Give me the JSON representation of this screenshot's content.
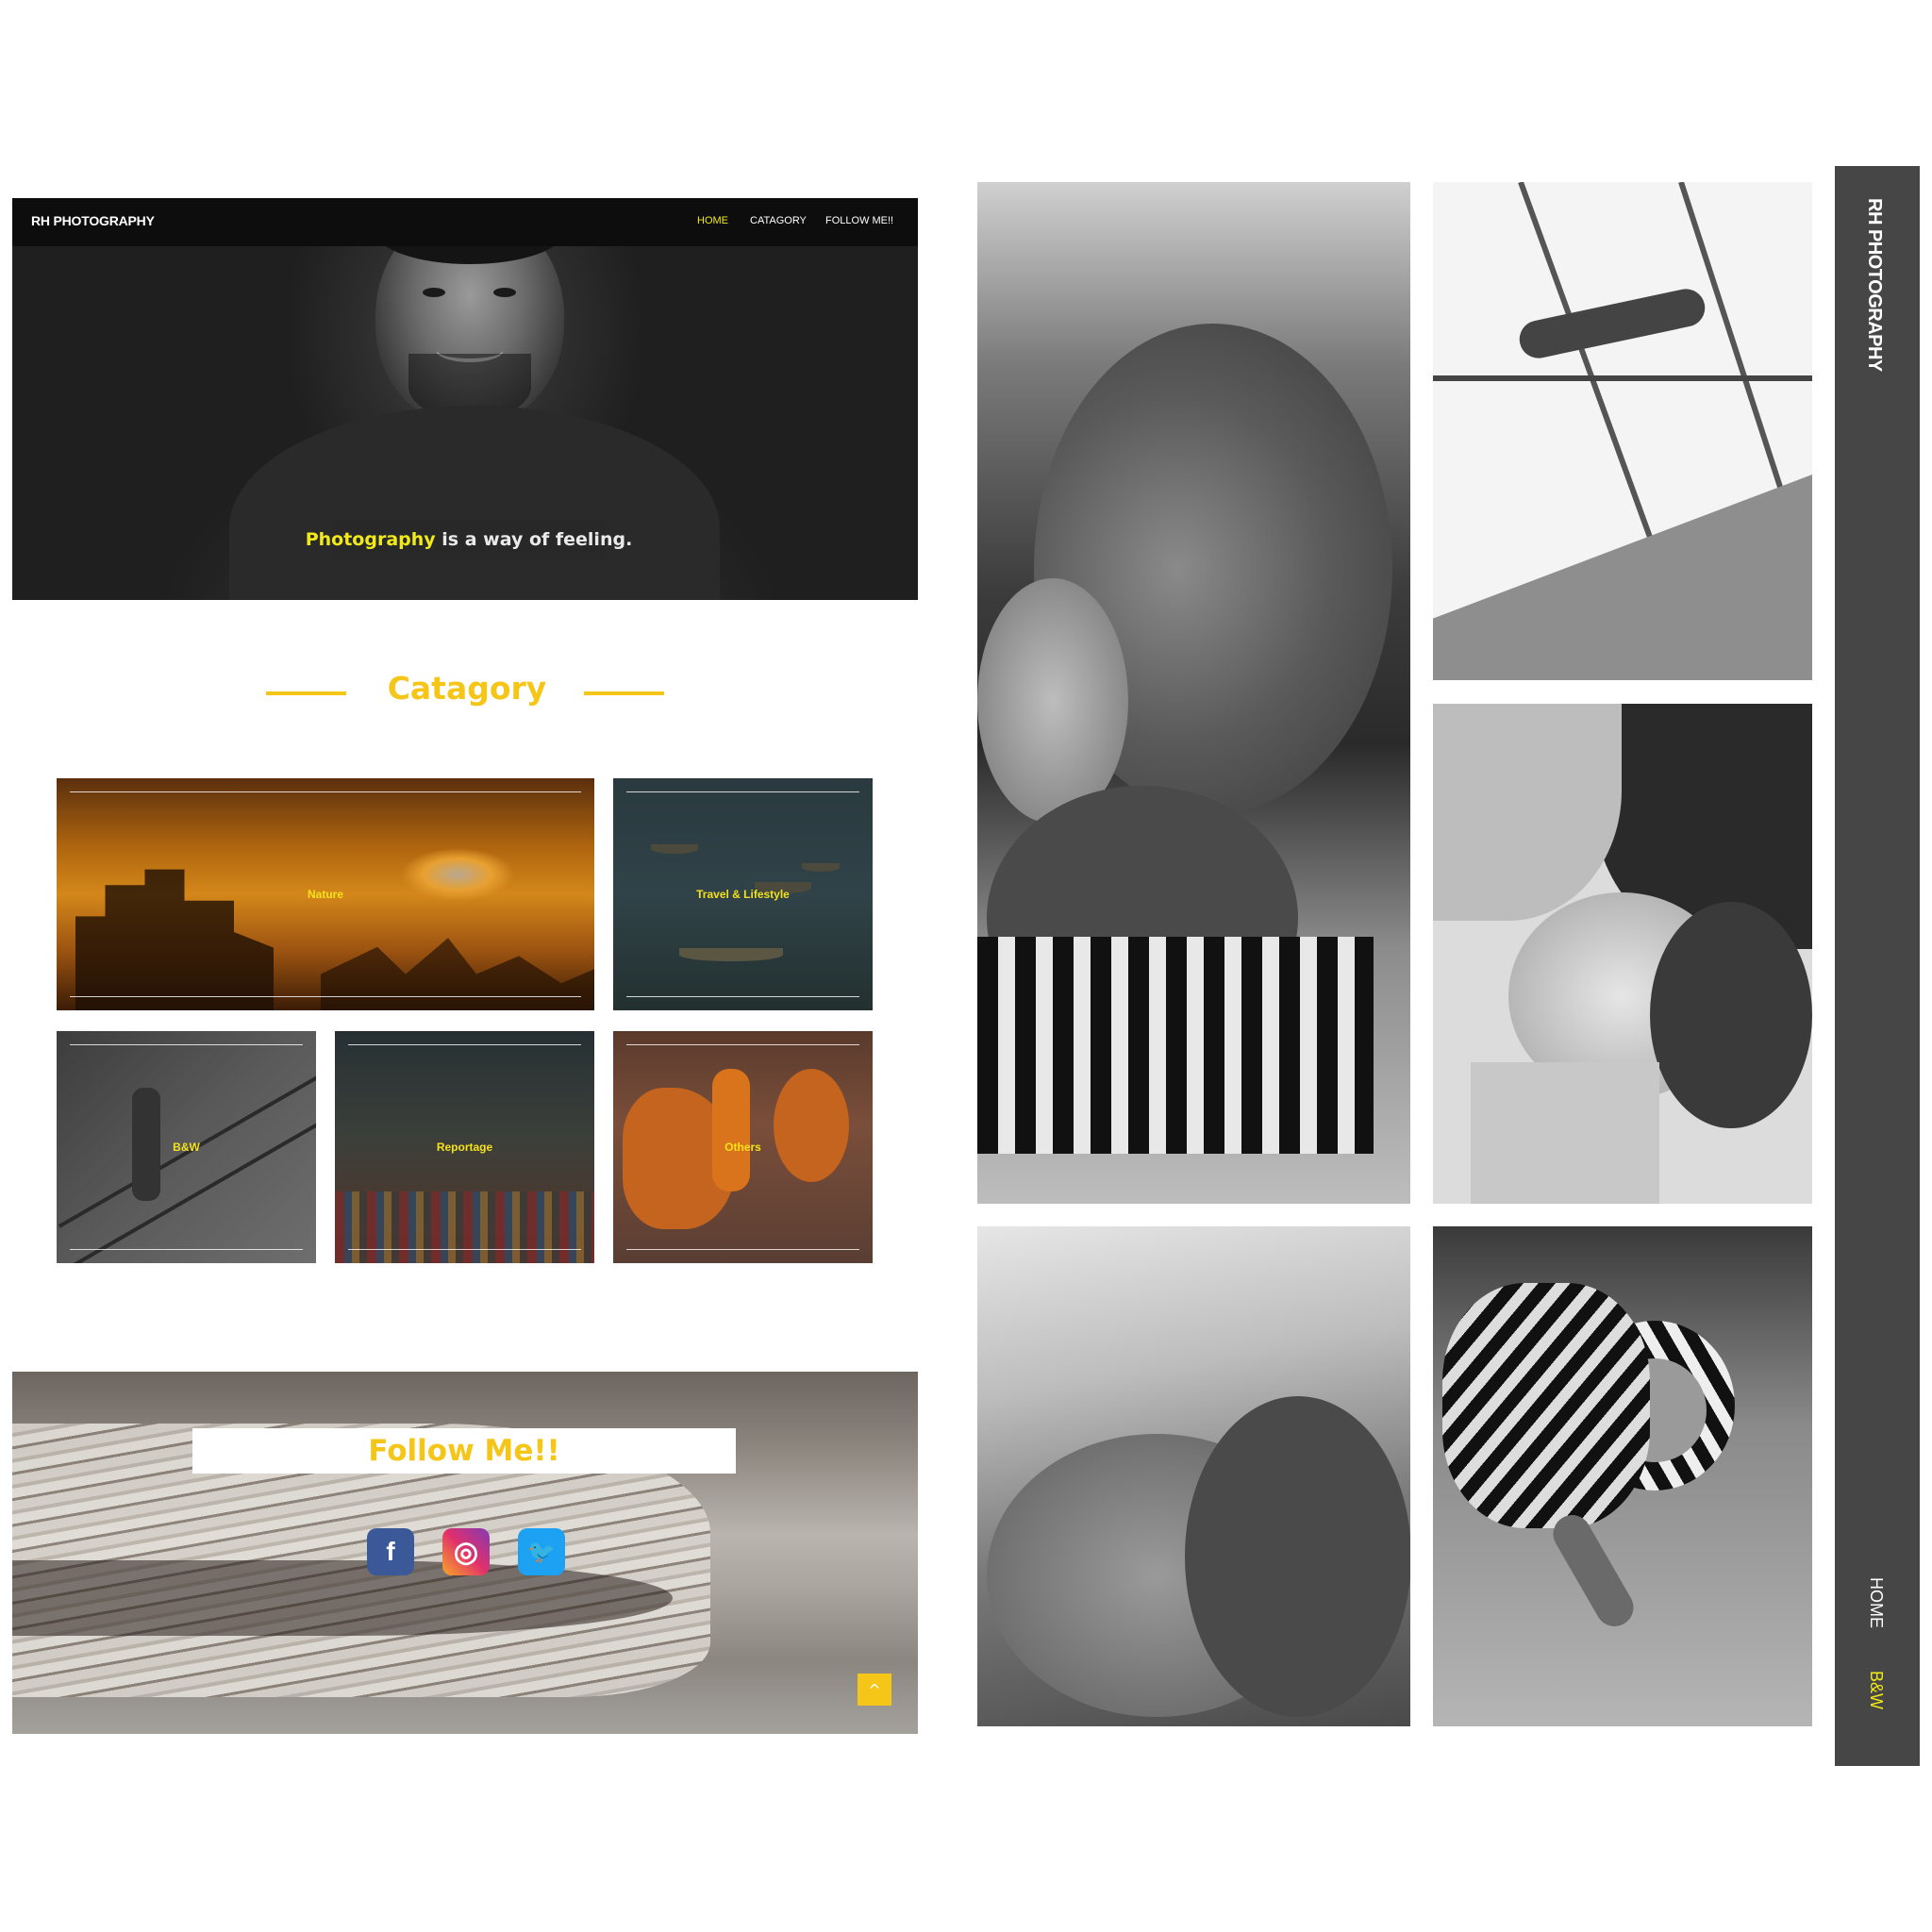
{
  "left_mockup": {
    "navbar": {
      "brand": "RH PHOTOGRAPHY",
      "links": [
        {
          "label": "HOME",
          "active": true
        },
        {
          "label": "CATAGORY",
          "active": false
        },
        {
          "label": "FOLLOW ME!!",
          "active": false
        }
      ]
    },
    "hero": {
      "tagline_highlight": "Photography",
      "tagline_rest": " is a way of feeling."
    },
    "category": {
      "title": "Catagory",
      "tiles": [
        {
          "label": "Nature"
        },
        {
          "label": "Travel & Lifestyle"
        },
        {
          "label": "B&W"
        },
        {
          "label": "Reportage"
        },
        {
          "label": "Others"
        }
      ]
    },
    "follow": {
      "title": "Follow Me!!",
      "socials": [
        {
          "name": "facebook",
          "glyph": "f"
        },
        {
          "name": "instagram",
          "glyph": "◎"
        },
        {
          "name": "twitter",
          "glyph": "🐦"
        }
      ],
      "scroll_top_glyph": "^"
    }
  },
  "right_mockup": {
    "sidebar": {
      "brand": "RH PHOTOGRAPHY",
      "links": [
        {
          "label": "HOME",
          "active": false
        },
        {
          "label": "B&W",
          "active": true
        }
      ]
    }
  },
  "colors": {
    "accent_yellow": "#f5c518",
    "nav_active": "#f2ea18",
    "navbar_bg": "#0d0d0d",
    "sidebar_bg": "#464646",
    "facebook": "#3b5998",
    "twitter": "#1da1f2"
  }
}
